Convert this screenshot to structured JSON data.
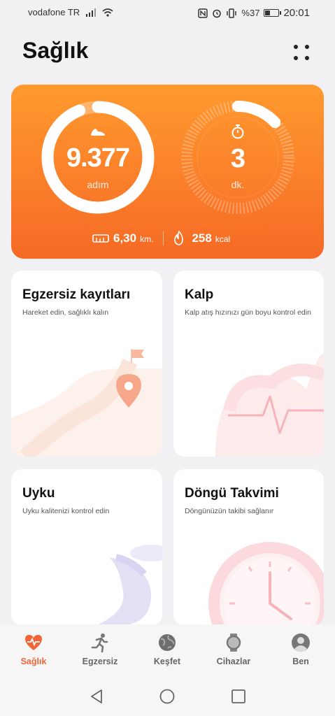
{
  "status_bar": {
    "carrier": "vodafone TR",
    "battery_text": "%37",
    "battery_level": 0.37,
    "time": "20:01",
    "icons": [
      "signal-icon",
      "wifi-icon",
      "nfc-icon",
      "alarm-icon",
      "vibrate-icon",
      "battery-icon"
    ]
  },
  "header": {
    "title": "Sağlık",
    "menu_icon": "grid-dots-icon"
  },
  "activity": {
    "steps_value": "9.377",
    "steps_unit": "adım",
    "steps_icon": "shoe-icon",
    "steps_progress": 0.94,
    "active_value": "3",
    "active_unit": "dk.",
    "active_icon": "stopwatch-icon",
    "active_progress": 0.13,
    "distance_value": "6,30",
    "distance_unit": "km.",
    "distance_icon": "ruler-icon",
    "calories_value": "258",
    "calories_unit": "kcal",
    "calories_icon": "flame-icon",
    "colors": {
      "start": "#ff9a2e",
      "end": "#f56a25"
    }
  },
  "cards": [
    {
      "title": "Egzersiz kayıtları",
      "subtitle": "Hareket edin, sağlıklı kalın",
      "illustration": "map-pin-path-icon"
    },
    {
      "title": "Kalp",
      "subtitle": "Kalp atış hızınızı gün boyu kontrol edin",
      "illustration": "heart-pulse-icon"
    },
    {
      "title": "Uyku",
      "subtitle": "Uyku kalitenizi kontrol edin",
      "illustration": "moon-icon"
    },
    {
      "title": "Döngü Takvimi",
      "subtitle": "Döngünüzün takibi sağlanır",
      "illustration": "clock-icon"
    }
  ],
  "bottom_nav": {
    "active": "Sağlık",
    "accent": "#f0663a",
    "items": [
      {
        "label": "Sağlık",
        "icon": "heart-icon"
      },
      {
        "label": "Egzersiz",
        "icon": "running-icon"
      },
      {
        "label": "Keşfet",
        "icon": "globe-icon"
      },
      {
        "label": "Cihazlar",
        "icon": "watch-icon"
      },
      {
        "label": "Ben",
        "icon": "person-icon"
      }
    ]
  },
  "system_nav": [
    "back-icon",
    "home-icon",
    "recents-icon"
  ]
}
